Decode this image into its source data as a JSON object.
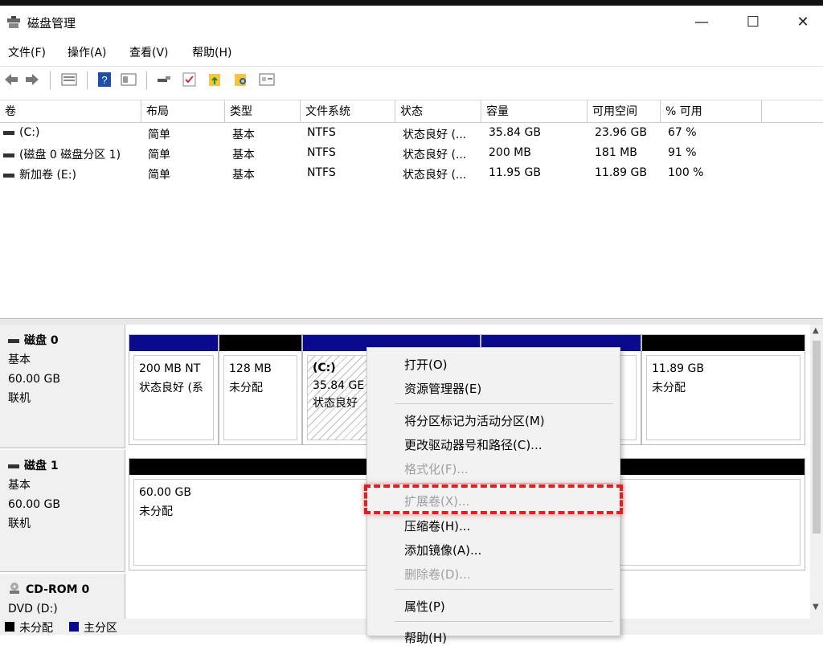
{
  "window": {
    "title": "磁盘管理",
    "minimize": "—",
    "maximize": "☐",
    "close": "✕"
  },
  "menu": [
    "文件(F)",
    "操作(A)",
    "查看(V)",
    "帮助(H)"
  ],
  "toolbar_icons": [
    "back-icon",
    "forward-icon",
    "list-view-icon",
    "help-icon",
    "properties-icon",
    "connect-icon",
    "check-icon",
    "folder-up-icon",
    "folder-search-icon",
    "settings-panel-icon"
  ],
  "list": {
    "columns": [
      "卷",
      "布局",
      "类型",
      "文件系统",
      "状态",
      "容量",
      "可用空间",
      "% 可用"
    ],
    "rows": [
      [
        "(C:)",
        "简单",
        "基本",
        "NTFS",
        "状态良好 (...",
        "35.84 GB",
        "23.96 GB",
        "67 %"
      ],
      [
        "(磁盘 0 磁盘分区 1)",
        "简单",
        "基本",
        "NTFS",
        "状态良好 (...",
        "200 MB",
        "181 MB",
        "91 %"
      ],
      [
        "新加卷 (E:)",
        "简单",
        "基本",
        "NTFS",
        "状态良好 (...",
        "11.95 GB",
        "11.89 GB",
        "100 %"
      ]
    ]
  },
  "disks": [
    {
      "name": "磁盘 0",
      "type": "基本",
      "size": "60.00 GB",
      "status": "联机"
    },
    {
      "name": "磁盘 1",
      "type": "基本",
      "size": "60.00 GB",
      "status": "联机"
    },
    {
      "name": "CD-ROM 0",
      "type": "DVD (D:)"
    }
  ],
  "partitions": {
    "p1": {
      "line1": "200 MB NT",
      "line2": "状态良好 (系"
    },
    "p2": {
      "line1": "128 MB",
      "line2": "未分配"
    },
    "p3": {
      "title": "(C:)",
      "line1": "35.84 GE",
      "line2": "状态良好"
    },
    "p5": {
      "line1": "11.89 GB",
      "line2": "未分配"
    },
    "d1": {
      "line1": "60.00 GB",
      "line2": "未分配"
    }
  },
  "legend": {
    "unallocated": "未分配",
    "primary": "主分区"
  },
  "colors": {
    "primary": "#0a0a8c",
    "unallocated": "#000000",
    "highlight": "#e02020"
  },
  "context_menu": {
    "open": "打开(O)",
    "explorer": "资源管理器(E)",
    "mark_active": "将分区标记为活动分区(M)",
    "change_letter": "更改驱动器号和路径(C)...",
    "format": "格式化(F)...",
    "extend": "扩展卷(X)...",
    "shrink": "压缩卷(H)...",
    "add_mirror": "添加镜像(A)...",
    "delete": "删除卷(D)...",
    "properties": "属性(P)",
    "help": "帮助(H)"
  }
}
